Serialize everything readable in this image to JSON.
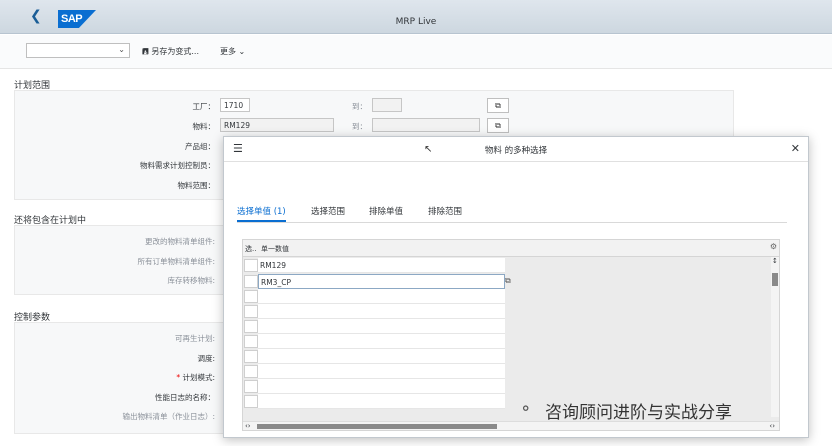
{
  "shell": {
    "title": "MRP Live",
    "logo": "SAP",
    "back_icon": "chevron-left-icon"
  },
  "toolbar": {
    "variant_value": "",
    "save_variant": "另存为变式...",
    "more": "更多"
  },
  "planning_scope": {
    "title": "计划范围",
    "plant_label": "工厂：",
    "plant_value": "1710",
    "material_label": "物料：",
    "material_value": "RM129",
    "to_label": "到：",
    "product_group_label": "产品组：",
    "mrp_controller_label": "物料需求计划控制员：",
    "material_scope_label": "物料范围："
  },
  "also_include": {
    "title": "还将包含在计划中",
    "changed_bom_label": "更改的物料清单组件:",
    "order_bom_label": "所有订单物料清单组件:",
    "stock_transfer_label": "库存转移物料:"
  },
  "control_params": {
    "title": "控制参数",
    "regen_label": "可再生计划:",
    "scheduling_label": "调度:",
    "plan_mode_label": "计划模式:",
    "perf_log_label": "性能日志的名称：",
    "output_bom_label": "输出物料清单（作业日志）:"
  },
  "dialog": {
    "title": "物料 的多种选择",
    "tabs": [
      {
        "label": "选择单值 (1)",
        "active": true
      },
      {
        "label": "选择范围",
        "active": false
      },
      {
        "label": "排除单值",
        "active": false
      },
      {
        "label": "排除范围",
        "active": false
      }
    ],
    "grid": {
      "col_select": "选..",
      "col_value": "单一数值",
      "rows": [
        "RM129",
        "RM3_CP",
        "",
        "",
        "",
        "",
        "",
        "",
        "",
        ""
      ]
    }
  },
  "watermark": "咨询顾问进阶与实战分享"
}
